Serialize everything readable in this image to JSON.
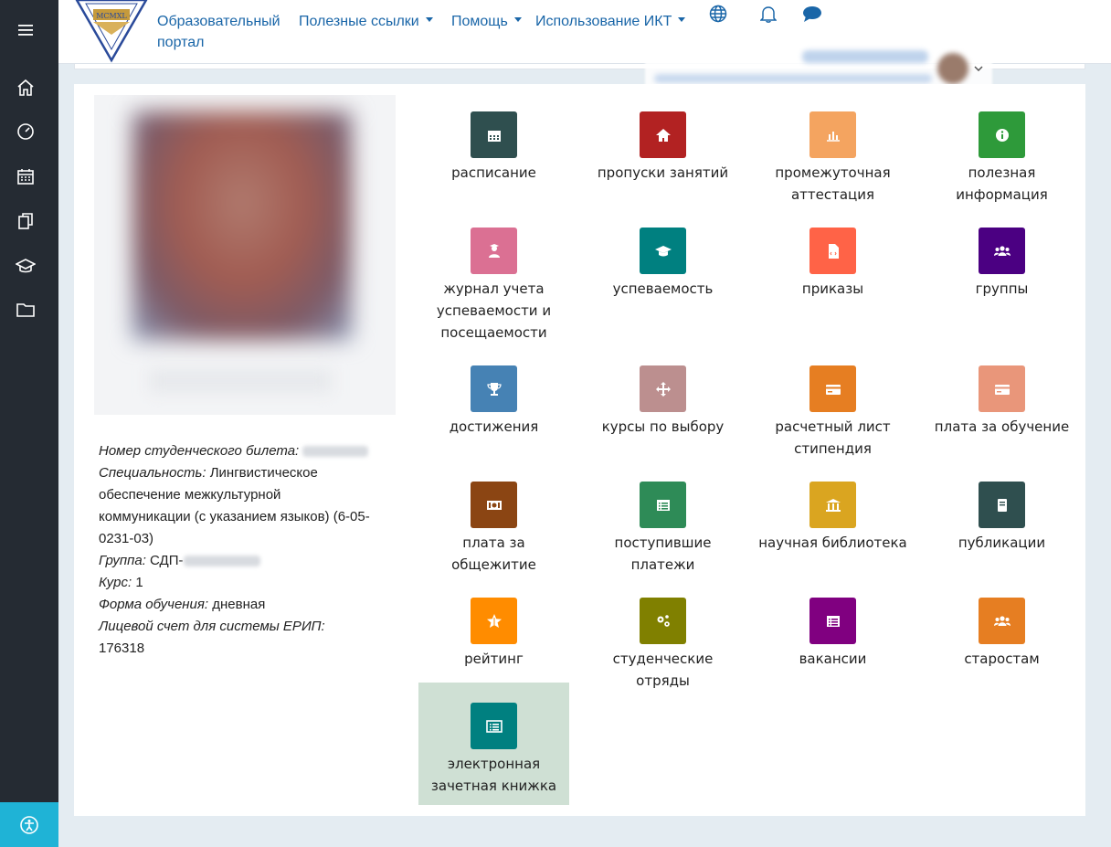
{
  "app": {
    "accent": "#1a66a8",
    "sidebar_bg": "#252b33"
  },
  "logo": {
    "text": "MCMXL"
  },
  "nav": {
    "portal": "Образовательный портал",
    "links": "Полезные ссылки",
    "help": "Помощь",
    "ict": "Использование ИКТ"
  },
  "sidebar": {
    "items": [
      {
        "icon": "home-icon"
      },
      {
        "icon": "dashboard-icon"
      },
      {
        "icon": "calendar-icon"
      },
      {
        "icon": "files-icon"
      },
      {
        "icon": "graduation-cap-icon"
      },
      {
        "icon": "folder-icon"
      }
    ],
    "accessibility_icon": "accessibility-icon"
  },
  "student": {
    "ticket_label": "Номер студенческого билета:",
    "specialty_label": "Специальность:",
    "specialty_value": "Лингвистическое обеспечение межкультурной коммуникации (с указанием языков) (6-05-0231-03)",
    "group_label": "Группа:",
    "group_value": "СДП-",
    "course_label": "Курс:",
    "course_value": "1",
    "form_label": "Форма обучения:",
    "form_value": "дневная",
    "account_label": "Лицевой счет для системы ЕРИП:",
    "account_value": "176318"
  },
  "tiles": [
    {
      "label": "расписание",
      "color": "#2f4f4f",
      "icon": "calendar-icon"
    },
    {
      "label": "пропуски занятий",
      "color": "#b22222",
      "icon": "home-icon"
    },
    {
      "label": "промежуточная аттестация",
      "color": "#f4a460",
      "icon": "bar-chart-icon"
    },
    {
      "label": "полезная информация",
      "color": "#2e9a3a",
      "icon": "info-icon"
    },
    {
      "label": "журнал учета успеваемости и посещаемости",
      "color": "#db7093",
      "icon": "teacher-icon"
    },
    {
      "label": "успеваемость",
      "color": "#008080",
      "icon": "graduation-cap-icon"
    },
    {
      "label": "приказы",
      "color": "#ff6347",
      "icon": "file-code-icon"
    },
    {
      "label": "группы",
      "color": "#4b0082",
      "icon": "users-icon"
    },
    {
      "label": "достижения",
      "color": "#4682b4",
      "icon": "trophy-icon"
    },
    {
      "label": "курсы по выбору",
      "color": "#bc8f8f",
      "icon": "arrows-icon"
    },
    {
      "label": "расчетный лист стипендия",
      "color": "#e67e22",
      "icon": "credit-card-icon"
    },
    {
      "label": "плата за обучение",
      "color": "#e9967a",
      "icon": "credit-card-icon"
    },
    {
      "label": "плата за общежитие",
      "color": "#8b4513",
      "icon": "money-icon"
    },
    {
      "label": "поступившие платежи",
      "color": "#2e8b57",
      "icon": "list-icon"
    },
    {
      "label": "научная библиотека",
      "color": "#daa520",
      "icon": "bank-icon"
    },
    {
      "label": "публикации",
      "color": "#2f4f4f",
      "icon": "book-icon"
    },
    {
      "label": "рейтинг",
      "color": "#ff8c00",
      "icon": "star-icon"
    },
    {
      "label": "студенческие отряды",
      "color": "#808000",
      "icon": "cogs-icon"
    },
    {
      "label": "вакансии",
      "color": "#800080",
      "icon": "list-icon"
    },
    {
      "label": "старостам",
      "color": "#e67e22",
      "icon": "users-icon"
    },
    {
      "label": "электронная зачетная книжка",
      "color": "#008080",
      "icon": "list-alt-icon"
    }
  ]
}
